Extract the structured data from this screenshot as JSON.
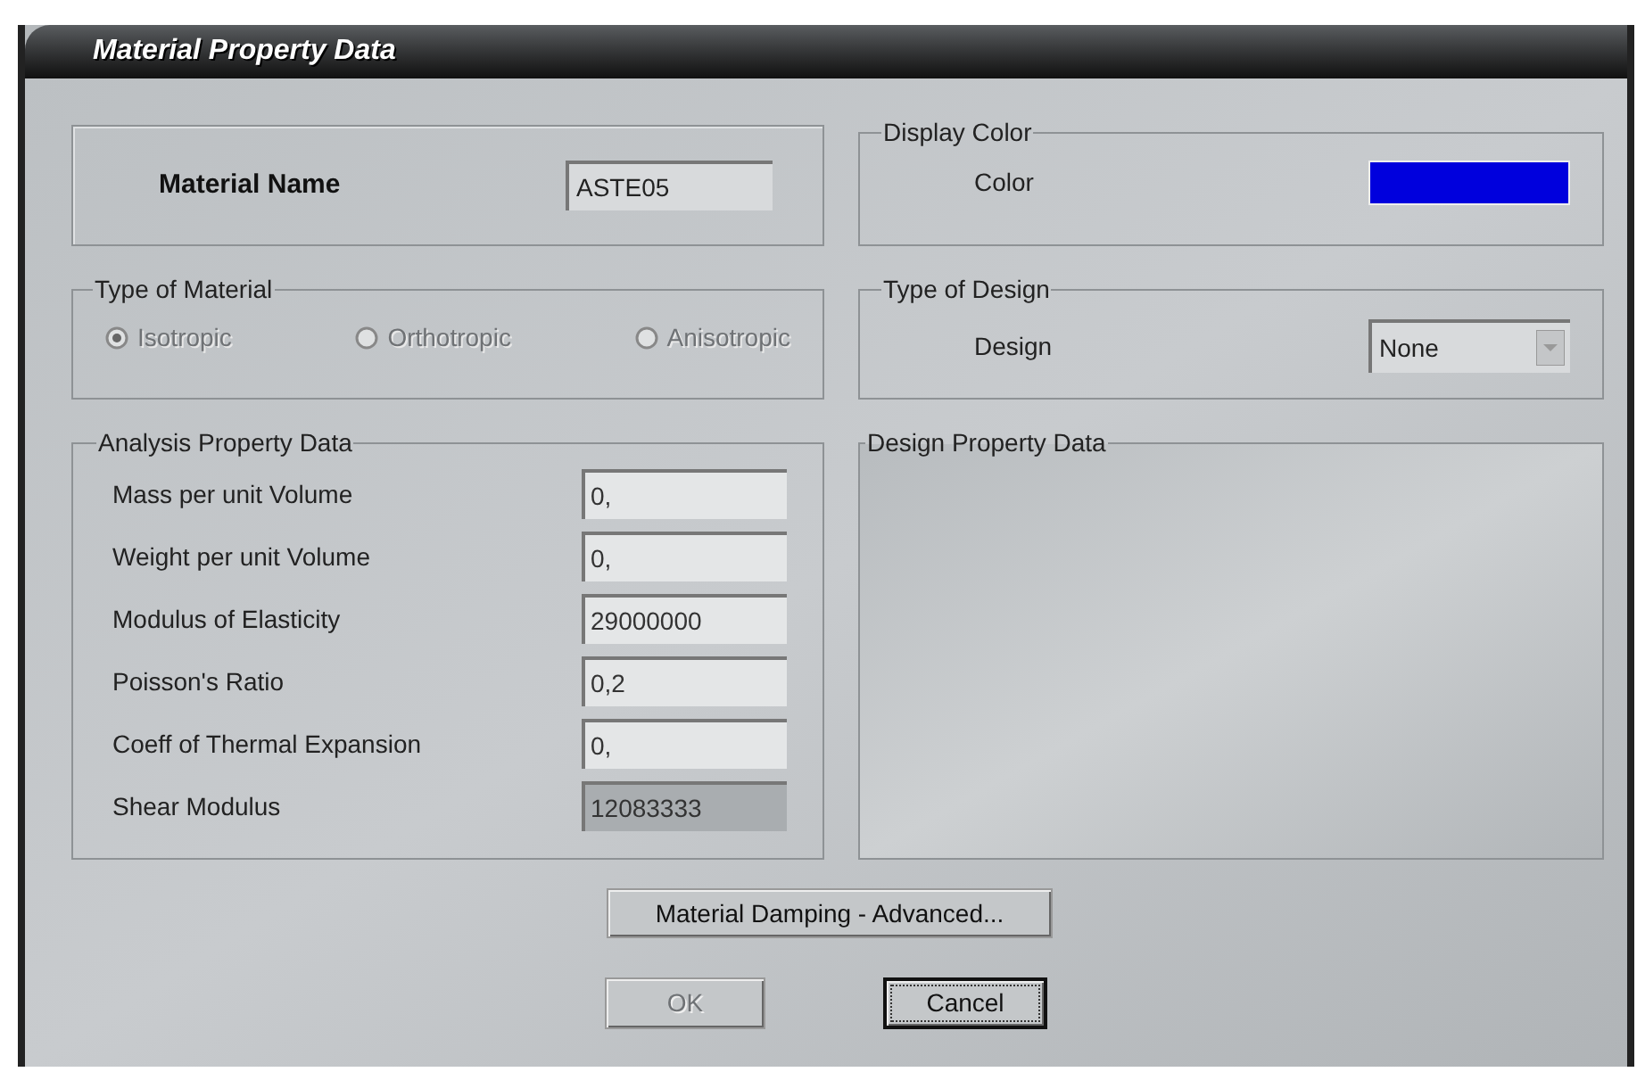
{
  "window": {
    "title": "Material Property Data"
  },
  "material_name": {
    "label": "Material Name",
    "value": "ASTE05"
  },
  "type_of_material": {
    "title": "Type of Material",
    "disabled": true,
    "options": [
      {
        "label": "Isotropic",
        "selected": true
      },
      {
        "label": "Orthotropic",
        "selected": false
      },
      {
        "label": "Anisotropic",
        "selected": false
      }
    ]
  },
  "analysis_property_data": {
    "title": "Analysis Property Data",
    "rows": [
      {
        "label": "Mass per unit Volume",
        "value": "0,",
        "readonly": false
      },
      {
        "label": "Weight per unit Volume",
        "value": "0,",
        "readonly": false
      },
      {
        "label": "Modulus of Elasticity",
        "value": "29000000",
        "readonly": false
      },
      {
        "label": "Poisson's Ratio",
        "value": "0,2",
        "readonly": false
      },
      {
        "label": "Coeff of Thermal Expansion",
        "value": "0,",
        "readonly": false
      },
      {
        "label": "Shear Modulus",
        "value": "12083333",
        "readonly": true
      }
    ]
  },
  "display_color": {
    "title": "Display Color",
    "label": "Color",
    "color": "#0000dd"
  },
  "type_of_design": {
    "title": "Type of Design",
    "label": "Design",
    "value": "None"
  },
  "design_property_data": {
    "title": "Design Property Data"
  },
  "buttons": [
    {
      "label": "Material Damping - Advanced...",
      "disabled": false,
      "default": false
    },
    {
      "label": "OK",
      "disabled": true,
      "default": false
    },
    {
      "label": "Cancel",
      "disabled": false,
      "default": true
    }
  ]
}
